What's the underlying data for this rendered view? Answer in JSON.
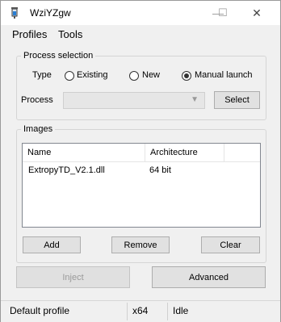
{
  "window": {
    "title": "WziYZgw",
    "minimize_glyph": "—",
    "maximize_glyph": "☐",
    "close_glyph": "✕"
  },
  "menu": {
    "items": [
      "Profiles",
      "Tools"
    ]
  },
  "process_selection": {
    "title": "Process selection",
    "type_label": "Type",
    "options": [
      {
        "label": "Existing",
        "selected": false
      },
      {
        "label": "New",
        "selected": false
      },
      {
        "label": "Manual launch",
        "selected": true
      }
    ],
    "process_label": "Process",
    "process_value": "",
    "select_button": "Select"
  },
  "images": {
    "title": "Images",
    "columns": [
      "Name",
      "Architecture"
    ],
    "rows": [
      {
        "name": "ExtropyTD_V2.1.dll",
        "architecture": "64 bit"
      }
    ],
    "add_button": "Add",
    "remove_button": "Remove",
    "clear_button": "Clear"
  },
  "actions": {
    "inject": "Inject",
    "advanced": "Advanced"
  },
  "status_bar": {
    "profile": "Default profile",
    "arch": "x64",
    "state": "Idle"
  },
  "icons": {
    "app": "syringe-icon",
    "combo_arrow": "chevron-down-icon"
  }
}
